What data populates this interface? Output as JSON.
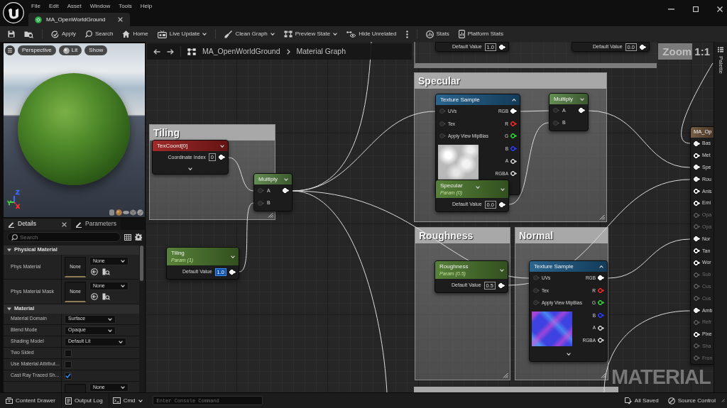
{
  "title_bar": {
    "menu": [
      "File",
      "Edit",
      "Asset",
      "Window",
      "Tools",
      "Help"
    ],
    "tabs": [
      {
        "label": "MA_OpenWorldGround",
        "selected": true
      }
    ]
  },
  "toolbar": [
    [
      {
        "kind": "icon"
      },
      {
        "kind": "icon"
      }
    ],
    [
      {
        "kind": "button",
        "label": "Apply",
        "dropdown": false
      },
      {
        "kind": "button",
        "label": "Search",
        "dropdown": false
      },
      {
        "kind": "button",
        "label": "Home",
        "dropdown": false
      },
      {
        "kind": "button",
        "label": "Live Update",
        "dropdown": true
      }
    ],
    [
      {
        "kind": "button",
        "label": "Clean Graph",
        "dropdown": true
      },
      {
        "kind": "button",
        "label": "Preview State",
        "dropdown": true
      },
      {
        "kind": "button",
        "label": "Hide Unrelated",
        "dropdown": false
      },
      {
        "kind": "icon"
      }
    ],
    [
      {
        "kind": "button",
        "label": "Stats",
        "dropdown": false
      },
      {
        "kind": "button",
        "label": "Platform Stats",
        "dropdown": false
      }
    ]
  ],
  "viewport": {
    "buttons": [
      "Perspective",
      "Lit",
      "Show"
    ],
    "axes": [
      {
        "label": "Z",
        "color": "#3d6bff"
      },
      {
        "label": "Y",
        "color": "#3fd13f"
      },
      {
        "label": "X",
        "color": "#ff3030"
      }
    ]
  },
  "details": {
    "tabs": [
      {
        "label": "Details",
        "selected": true
      },
      {
        "label": "Parameters",
        "selected": false
      }
    ],
    "search": {
      "placeholder": "Search"
    },
    "sections": [
      {
        "title": "Physical Material",
        "expanded": true,
        "rows": [
          {
            "kind": "asset",
            "label": "Phys Material",
            "thumbnail": "None",
            "value": "None"
          },
          {
            "kind": "asset",
            "label": "Phys Material Mask",
            "thumbnail": "None",
            "value": "None"
          }
        ]
      },
      {
        "title": "Material",
        "expanded": true,
        "rows": [
          {
            "kind": "dropdown",
            "label": "Material Domain",
            "value": "Surface"
          },
          {
            "kind": "dropdown",
            "label": "Blend Mode",
            "value": "Opaque"
          },
          {
            "kind": "dropdown",
            "label": "Shading Model",
            "value": "Default Lit"
          },
          {
            "kind": "checkbox",
            "label": "Two Sided",
            "checked": false
          },
          {
            "kind": "checkbox",
            "label": "Use Material Attribut...",
            "checked": false
          },
          {
            "kind": "checkbox",
            "label": "Cast Ray Traced Sh...",
            "checked": true
          },
          {
            "kind": "asset",
            "value": "None"
          }
        ]
      }
    ]
  },
  "graph": {
    "breadcrumb": [
      "MA_OpenWorldGround",
      "Material Graph"
    ],
    "zoom_label": "Zoom 1:1",
    "watermark": "MATERIAL",
    "comments": [
      {
        "title": "Tiling"
      },
      {
        "title": "Specular"
      },
      {
        "title": "Roughness"
      },
      {
        "title": "Normal"
      }
    ],
    "nodes": [
      {
        "kind": "value",
        "label": "Default Value",
        "value": "1.0",
        "output_connected": true
      },
      {
        "kind": "value",
        "label": "Default Value",
        "value": "0.0",
        "output_connected": true
      },
      {
        "kind": "texture",
        "title": "Texture Sample",
        "color": "#1d5b87",
        "inputs": [
          "UVs",
          "Tex",
          "Apply View MipBias"
        ],
        "outputs": [
          {
            "label": "RGB",
            "color": "#ffffff",
            "connected": true
          },
          {
            "label": "R",
            "color": "#e02424",
            "connected": false
          },
          {
            "label": "G",
            "color": "#22c32a",
            "connected": false
          },
          {
            "label": "B",
            "color": "#2a35e6",
            "connected": false
          },
          {
            "label": "A",
            "color": "#bbbbbb",
            "connected": false
          },
          {
            "label": "RGBA",
            "color": "#bbbbbb",
            "connected": false
          }
        ],
        "thumbnail": {
          "kind": "grayscale"
        }
      },
      {
        "kind": "math",
        "title": "Multiply",
        "color": "#5b8748",
        "inputs": [
          "A",
          "B"
        ],
        "output_connected": true
      },
      {
        "kind": "output",
        "title": "MA_Op",
        "color": "#6e543a",
        "pins": [
          {
            "label": "Bas",
            "connected": true,
            "disabled": false
          },
          {
            "label": "Met",
            "connected": false,
            "disabled": false
          },
          {
            "label": "Spe",
            "connected": true,
            "disabled": false
          },
          {
            "label": "Rou",
            "connected": true,
            "disabled": false
          },
          {
            "label": "Anis",
            "connected": false,
            "disabled": false
          },
          {
            "label": "Emi",
            "connected": false,
            "disabled": false
          },
          {
            "label": "Opa",
            "connected": false,
            "disabled": true
          },
          {
            "label": "Opa",
            "connected": false,
            "disabled": true
          },
          {
            "label": "Nor",
            "connected": true,
            "disabled": false
          },
          {
            "label": "Tan",
            "connected": false,
            "disabled": false
          },
          {
            "label": "Wor",
            "connected": false,
            "disabled": false
          },
          {
            "label": "Sub",
            "connected": false,
            "disabled": true
          },
          {
            "label": "Cus",
            "connected": false,
            "disabled": true
          },
          {
            "label": "Cus",
            "connected": false,
            "disabled": true
          },
          {
            "label": "Amb",
            "connected": true,
            "disabled": false
          },
          {
            "label": "Refr",
            "connected": false,
            "disabled": true
          },
          {
            "label": "Pixe",
            "connected": false,
            "disabled": false
          },
          {
            "label": "Sha",
            "connected": false,
            "disabled": true
          },
          {
            "label": "Fron",
            "connected": false,
            "disabled": true
          }
        ]
      },
      {
        "kind": "texcoord",
        "title": "TexCoord[0]",
        "color": "#9a1d1d",
        "label": "Coordinate Index",
        "value": "0",
        "output_connected": true
      },
      {
        "kind": "math",
        "title": "Multiply",
        "color": "#5b8748",
        "inputs": [
          "A",
          "B"
        ],
        "output_connected": true
      },
      {
        "kind": "param",
        "title": "Specular",
        "subtitle": "Param (0)",
        "color": "#4d7a2e",
        "label": "Default Value",
        "value": "0.0",
        "editing": false,
        "output_connected": true
      },
      {
        "kind": "param",
        "title": "Tiling",
        "subtitle": "Param (1)",
        "color": "#4d7a2e",
        "label": "Default Value",
        "value": "1.0",
        "editing": true,
        "output_connected": true
      },
      {
        "kind": "param",
        "title": "Roughness",
        "subtitle": "Param (0.5)",
        "color": "#4d7a2e",
        "label": "Default Value",
        "value": "0.5",
        "editing": false,
        "output_connected": true
      },
      {
        "kind": "texture",
        "title": "Texture Sample",
        "color": "#1d5b87",
        "inputs": [
          "UVs",
          "Tex",
          "Apply View MipBias"
        ],
        "outputs": [
          {
            "label": "RGB",
            "color": "#ffffff",
            "connected": true
          },
          {
            "label": "R",
            "color": "#e02424",
            "connected": false
          },
          {
            "label": "G",
            "color": "#22c32a",
            "connected": false
          },
          {
            "label": "B",
            "color": "#2a35e6",
            "connected": false
          },
          {
            "label": "A",
            "color": "#bbbbbb",
            "connected": false
          },
          {
            "label": "RGBA",
            "color": "#bbbbbb",
            "connected": false
          }
        ],
        "thumbnail": {
          "kind": "normal"
        }
      }
    ]
  },
  "palette": {
    "label": "Palette"
  },
  "status_bar": {
    "left": [
      {
        "label": "Content Drawer",
        "dropdown": false
      },
      {
        "label": "Output Log",
        "dropdown": false
      },
      {
        "label": "Cmd",
        "dropdown": true
      }
    ],
    "console_placeholder": "Enter Console Command",
    "right": [
      "All Saved",
      "Source Control"
    ]
  }
}
